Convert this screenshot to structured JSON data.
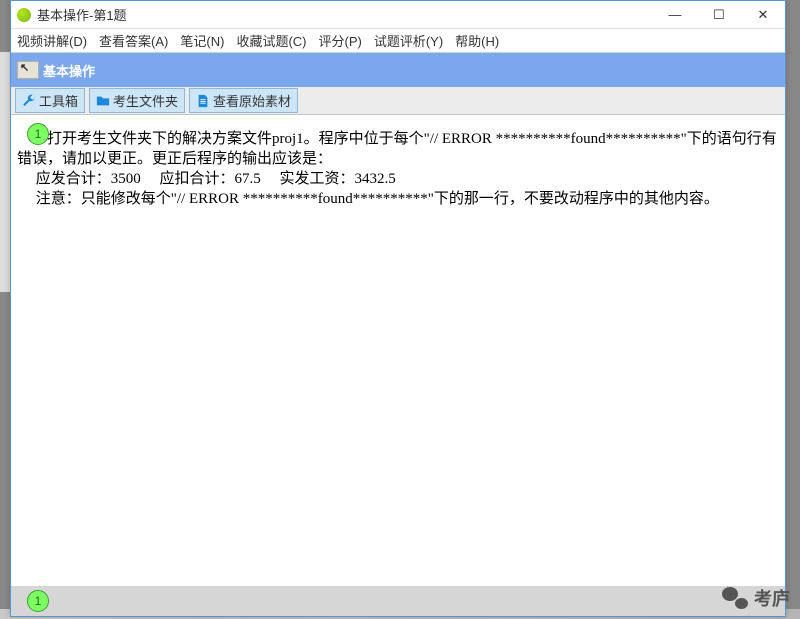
{
  "window": {
    "title": "基本操作-第1题",
    "min_label": "—",
    "max_label": "☐",
    "close_label": "✕"
  },
  "menu": {
    "items": [
      "视频讲解(D)",
      "查看答案(A)",
      "笔记(N)",
      "收藏试题(C)",
      "评分(P)",
      "试题评析(Y)",
      "帮助(H)"
    ]
  },
  "tabs": {
    "active": "基本操作"
  },
  "toolbar": {
    "toolbox": "工具箱",
    "candidate_folder": "考生文件夹",
    "view_raw": "查看原始素材"
  },
  "question": {
    "number_top": "1",
    "text": "        打开考生文件夹下的解决方案文件proj1。程序中位于每个\"// ERROR **********found**********\"下的语句行有错误，请加以更正。更正后程序的输出应该是：\n     应发合计：3500     应扣合计：67.5     实发工资：3432.5\n     注意：只能修改每个\"// ERROR **********found**********\"下的那一行，不要改动程序中的其他内容。"
  },
  "footer": {
    "number": "1"
  },
  "overlay": {
    "watermark": "考庐"
  }
}
